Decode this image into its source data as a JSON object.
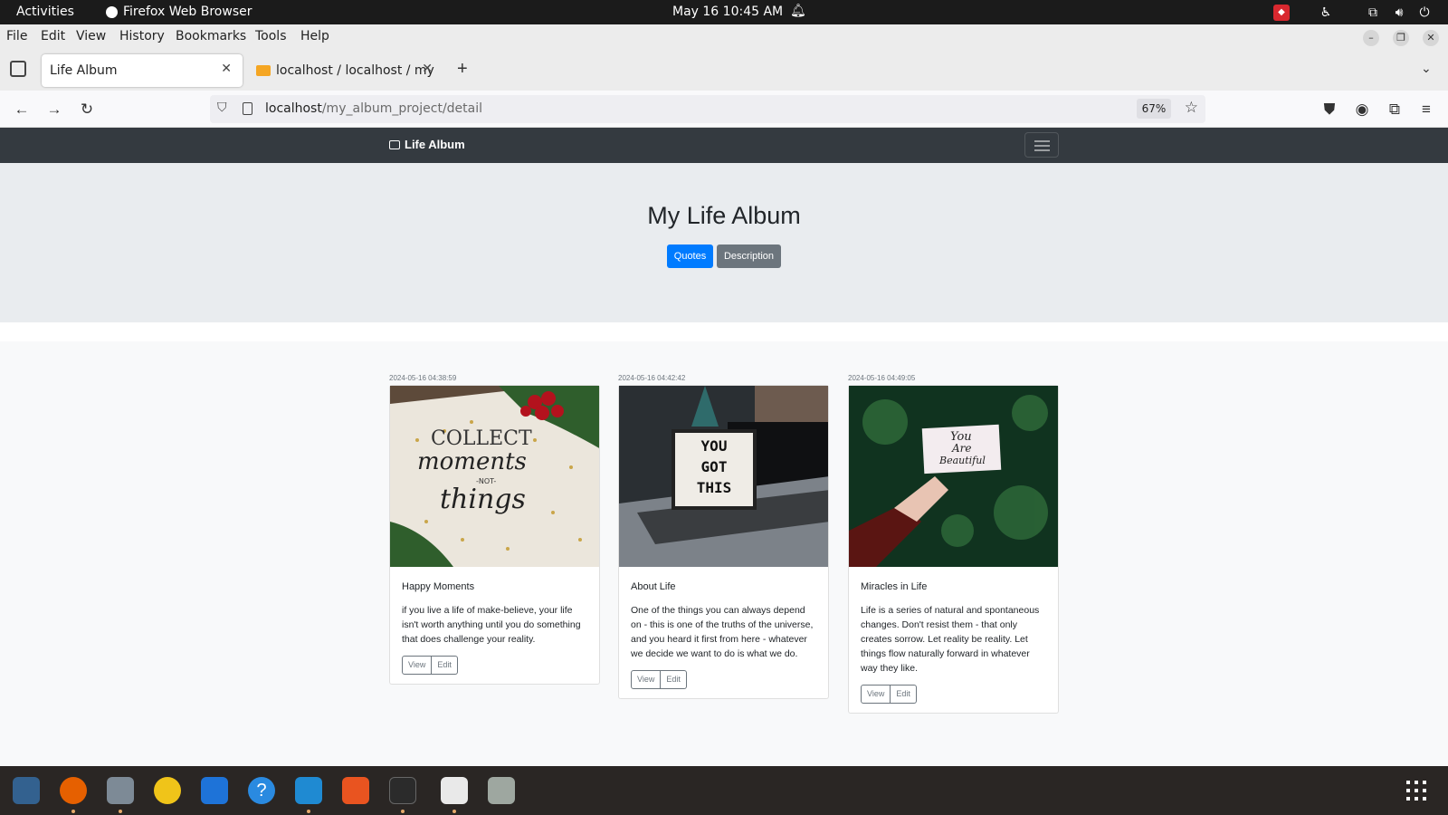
{
  "topbar": {
    "activities": "Activities",
    "app_name": "Firefox Web Browser",
    "clock": "May 16  10:45 AM"
  },
  "menubar": {
    "items": [
      "File",
      "Edit",
      "View",
      "History",
      "Bookmarks",
      "Tools",
      "Help"
    ]
  },
  "tabs": [
    {
      "label": "Life Album",
      "active": true
    },
    {
      "label": "localhost / localhost / my",
      "active": false
    }
  ],
  "navbar": {
    "url_host": "localhost",
    "url_path": "/my_album_project/detail",
    "zoom": "67%"
  },
  "site": {
    "brand": "Life Album",
    "heading": "My Life Album",
    "buttons": {
      "quotes": "Quotes",
      "description": "Description"
    },
    "colors": {
      "primary": "#007bff",
      "secondary": "#6c757d",
      "navbar": "#343a40"
    }
  },
  "cards": [
    {
      "timestamp": "2024-05-16 04:38:59",
      "title": "Happy Moments",
      "text": "if you live a life of make-believe, your life isn't worth anything until you do something that does challenge your reality.",
      "view": "View",
      "edit": "Edit"
    },
    {
      "timestamp": "2024-05-16 04:42:42",
      "title": "About Life",
      "text": "One of the things you can always depend on - this is one of the truths of the universe, and you heard it first from here - whatever we decide we want to do is what we do.",
      "view": "View",
      "edit": "Edit"
    },
    {
      "timestamp": "2024-05-16 04:49:05",
      "title": "Miracles in Life",
      "text": "Life is a series of natural and spontaneous changes. Don't resist them - that only creates sorrow. Let reality be reality. Let things flow naturally forward in whatever way they like.",
      "view": "View",
      "edit": "Edit"
    }
  ],
  "dock": {
    "icons": [
      "pgadmin-icon",
      "firefox-icon",
      "files-icon",
      "rhythmbox-icon",
      "writer-icon",
      "help-icon",
      "vscode-icon",
      "app-center-icon",
      "terminal-icon",
      "text-editor-icon",
      "trash-icon",
      "app-grid-icon"
    ]
  }
}
